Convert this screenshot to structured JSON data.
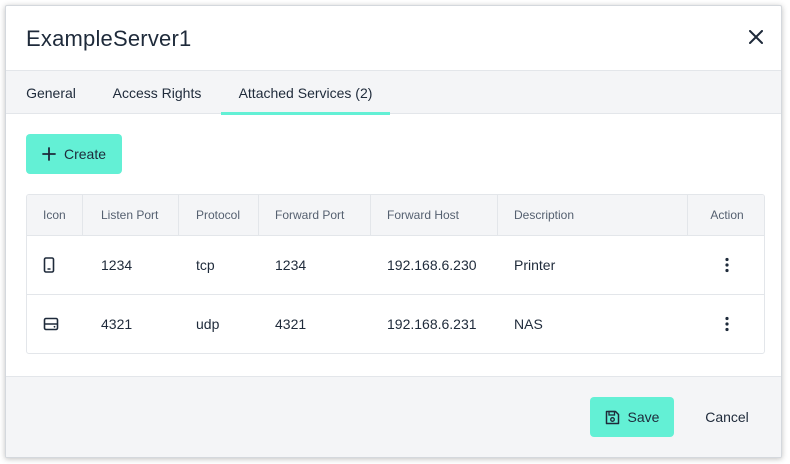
{
  "dialog": {
    "title": "ExampleServer1"
  },
  "icons": {
    "close": "close-icon",
    "create": "plus-icon",
    "save": "floppy-disk-icon",
    "action": "kebab-menu-icon",
    "row_icons": [
      "mobile-device-icon",
      "storage-drive-icon"
    ]
  },
  "tabs": [
    {
      "label": "General",
      "active": false
    },
    {
      "label": "Access Rights",
      "active": false
    },
    {
      "label": "Attached Services (2)",
      "active": true
    }
  ],
  "toolbar": {
    "create_label": "Create"
  },
  "table": {
    "columns": [
      "Icon",
      "Listen Port",
      "Protocol",
      "Forward Port",
      "Forward Host",
      "Description",
      "Action"
    ],
    "rows": [
      {
        "icon": "mobile-device-icon",
        "listen_port": "1234",
        "protocol": "tcp",
        "forward_port": "1234",
        "forward_host": "192.168.6.230",
        "description": "Printer"
      },
      {
        "icon": "storage-drive-icon",
        "listen_port": "4321",
        "protocol": "udp",
        "forward_port": "4321",
        "forward_host": "192.168.6.231",
        "description": "NAS"
      }
    ]
  },
  "footer": {
    "save_label": "Save",
    "cancel_label": "Cancel"
  },
  "colors": {
    "accent": "#63f0d5",
    "panel_bg": "#f4f5f7",
    "border": "#e3e6ea",
    "text": "#1e2a3a"
  }
}
